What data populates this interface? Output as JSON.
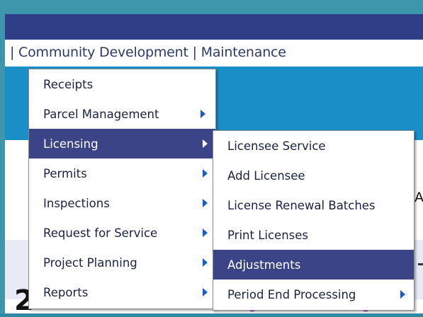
{
  "nav": {
    "text": "| Community Development | Maintenance"
  },
  "main_menu": {
    "items": [
      {
        "label": "Receipts",
        "has_submenu": false,
        "active": false
      },
      {
        "label": "Parcel Management",
        "has_submenu": true,
        "active": false
      },
      {
        "label": "Licensing",
        "has_submenu": true,
        "active": true
      },
      {
        "label": "Permits",
        "has_submenu": true,
        "active": false
      },
      {
        "label": "Inspections",
        "has_submenu": true,
        "active": false
      },
      {
        "label": "Request for Service",
        "has_submenu": true,
        "active": false
      },
      {
        "label": "Project Planning",
        "has_submenu": true,
        "active": false
      },
      {
        "label": "Reports",
        "has_submenu": true,
        "active": false
      }
    ]
  },
  "sub_menu": {
    "items": [
      {
        "label": "Licensee Service",
        "has_submenu": false,
        "active": false
      },
      {
        "label": "Add Licensee",
        "has_submenu": false,
        "active": false
      },
      {
        "label": "License Renewal Batches",
        "has_submenu": false,
        "active": false
      },
      {
        "label": "Print Licenses",
        "has_submenu": false,
        "active": false
      },
      {
        "label": "Adjustments",
        "has_submenu": false,
        "active": true
      },
      {
        "label": "Period End Processing",
        "has_submenu": true,
        "active": false
      }
    ]
  },
  "background": {
    "edge_letter": "A",
    "stat_1": "2",
    "stat_2": "",
    "stat_3": ""
  },
  "colors": {
    "header": "#2e3f88",
    "band": "#1a8fc7",
    "highlight": "#3c4488",
    "frame": "#3e96ad"
  }
}
